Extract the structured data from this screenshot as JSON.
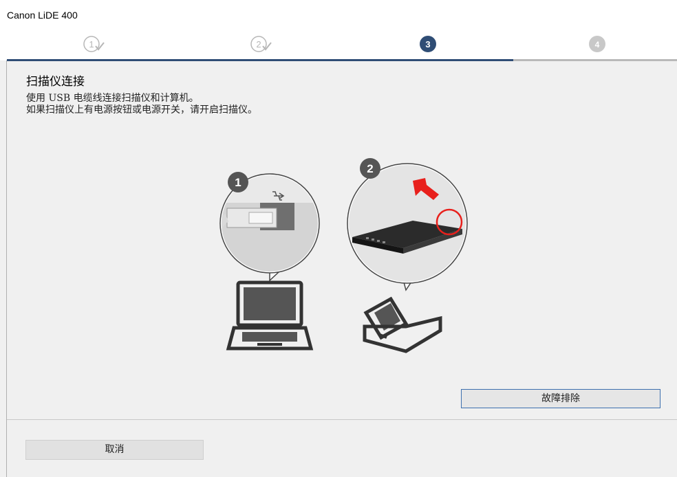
{
  "window": {
    "title": "Canon LiDE 400"
  },
  "steps": [
    {
      "label": "1",
      "state": "done"
    },
    {
      "label": "2",
      "state": "done"
    },
    {
      "label": "3",
      "state": "current"
    },
    {
      "label": "4",
      "state": "pending"
    }
  ],
  "progress": {
    "completed_steps": 3,
    "total_steps": 4
  },
  "main": {
    "heading": "扫描仪连接",
    "lines": [
      "使用 USB 电缆线连接扫描仪和计算机。",
      "如果扫描仪上有电源按钮或电源开关，请开启扫描仪。"
    ],
    "illustration": {
      "callout_1_number": "1",
      "callout_2_number": "2"
    }
  },
  "buttons": {
    "troubleshoot": "故障排除",
    "cancel": "取消"
  },
  "colors": {
    "accent": "#2f4d75",
    "step_done": "#b7b7b7",
    "step_pending": "#c8c8c8",
    "arrow_red": "#e8201c"
  }
}
